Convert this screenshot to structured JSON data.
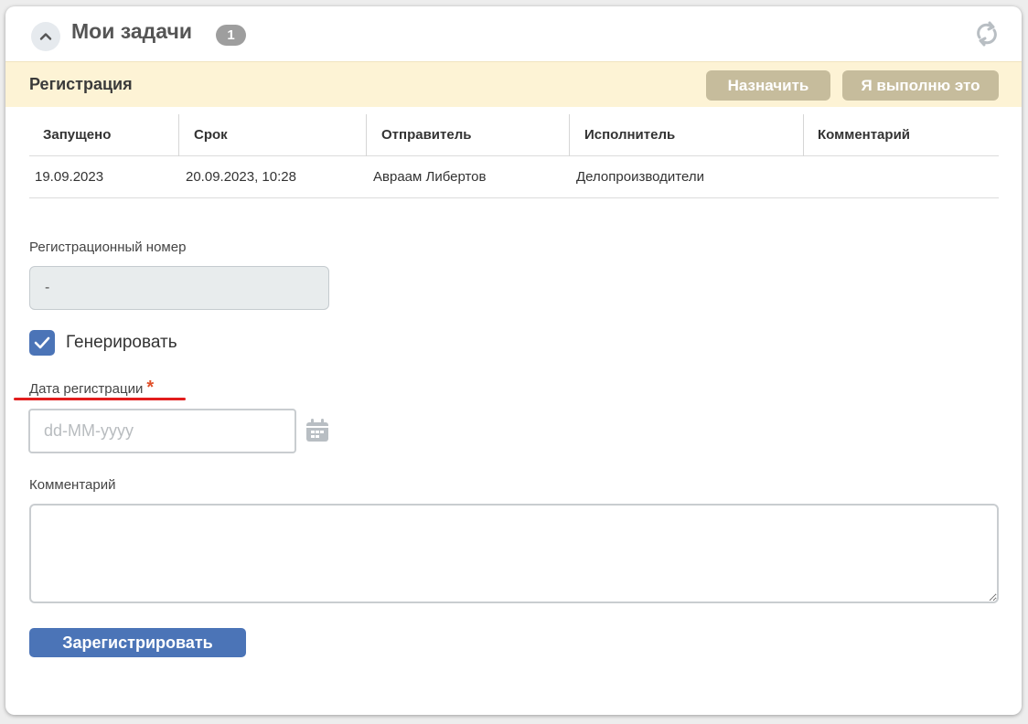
{
  "header": {
    "title": "Мои задачи",
    "count": "1"
  },
  "task": {
    "name": "Регистрация",
    "assign_label": "Назначить",
    "do_it_label": "Я выполню это"
  },
  "table": {
    "columns": [
      "Запущено",
      "Срок",
      "Отправитель",
      "Исполнитель",
      "Комментарий"
    ],
    "rows": [
      [
        "19.09.2023",
        "20.09.2023, 10:28",
        "Авраам Либертов",
        "Делопроизводители",
        ""
      ]
    ]
  },
  "form": {
    "reg_number_label": "Регистрационный номер",
    "reg_number_value": "-",
    "generate_label": "Генерировать",
    "generate_checked": true,
    "date_label": "Дата регистрации",
    "required_mark": "*",
    "date_placeholder": "dd-MM-yyyy",
    "date_value": "",
    "comment_label": "Комментарий",
    "comment_value": "",
    "submit_label": "Зарегистрировать"
  },
  "colors": {
    "accent": "#4b74b7",
    "taskbar_bg": "#fdf3d5",
    "khaki_button": "#c6bc9c",
    "badge_bg": "#9e9e9e",
    "required": "#e0502a",
    "annotation_underline": "#e21d1d"
  },
  "icons": {
    "collapse": "chevron-up-icon",
    "refresh": "refresh-icon",
    "checkbox": "check-icon",
    "calendar": "calendar-icon"
  }
}
